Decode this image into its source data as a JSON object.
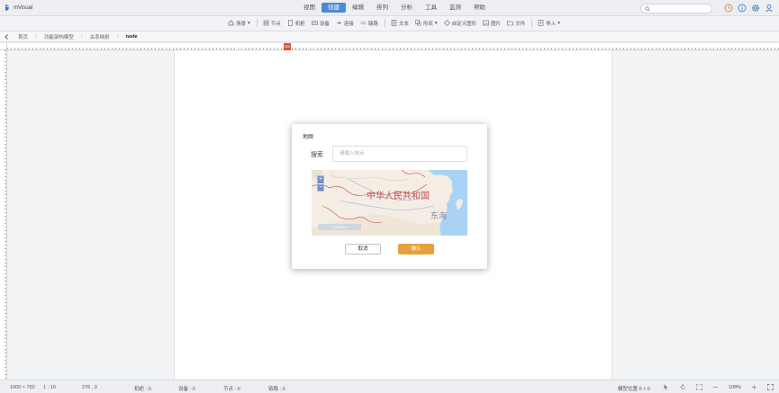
{
  "app": {
    "name": "mVisual"
  },
  "menus": [
    "视图",
    "创建",
    "编辑",
    "排列",
    "分析",
    "工具",
    "监测",
    "帮助"
  ],
  "active_menu": "创建",
  "close_glyph": "×",
  "header_icons": [
    "search-icon",
    "clock-icon",
    "info-icon",
    "gear-icon",
    "user-icon"
  ],
  "toolbar": [
    {
      "label": "场景",
      "icon": "scene-icon",
      "dropdown": true
    },
    {
      "label": "节点",
      "icon": "node-icon"
    },
    {
      "label": "机柜",
      "icon": "cabinet-icon"
    },
    {
      "label": "设备",
      "icon": "device-icon"
    },
    {
      "label": "连接",
      "icon": "link-icon"
    },
    {
      "label": "链路",
      "icon": "chain-icon"
    },
    {
      "label": "文本",
      "icon": "text-icon"
    },
    {
      "label": "形状",
      "icon": "shape-icon",
      "dropdown": true
    },
    {
      "label": "自定义图形",
      "icon": "custom-shape-icon"
    },
    {
      "label": "图片",
      "icon": "image-icon"
    },
    {
      "label": "文件",
      "icon": "file-icon"
    },
    {
      "label": "导入",
      "icon": "import-icon",
      "dropdown": true
    }
  ],
  "breadcrumb": [
    "首页",
    "功能架构模型",
    "关系映射",
    "node"
  ],
  "ruler_marker": "300",
  "status": {
    "size": "1000 × 750",
    "ratio": "1 : 10",
    "coords": "276 , 0",
    "cabinets": "机柜 : 0",
    "devices": "设备 : 0",
    "nodes": "节点 : 0",
    "links": "链路 : 0",
    "offset": "模型位置 0 × 0",
    "zoom": "108%"
  },
  "dialog": {
    "title": "地图",
    "search_label": "搜索",
    "search_placeholder": "请输入地点",
    "map_label_country": "中华人民共和国",
    "map_label_sea": "东海",
    "scale_text": "1000 km",
    "zoom_in": "+",
    "zoom_out": "−",
    "cancel": "取消",
    "confirm": "确认"
  },
  "colors": {
    "accent": "#4a8bd6",
    "confirm": "#e4a23c",
    "ruler_marker": "#e54b3d",
    "sea": "#a9d3f5"
  }
}
